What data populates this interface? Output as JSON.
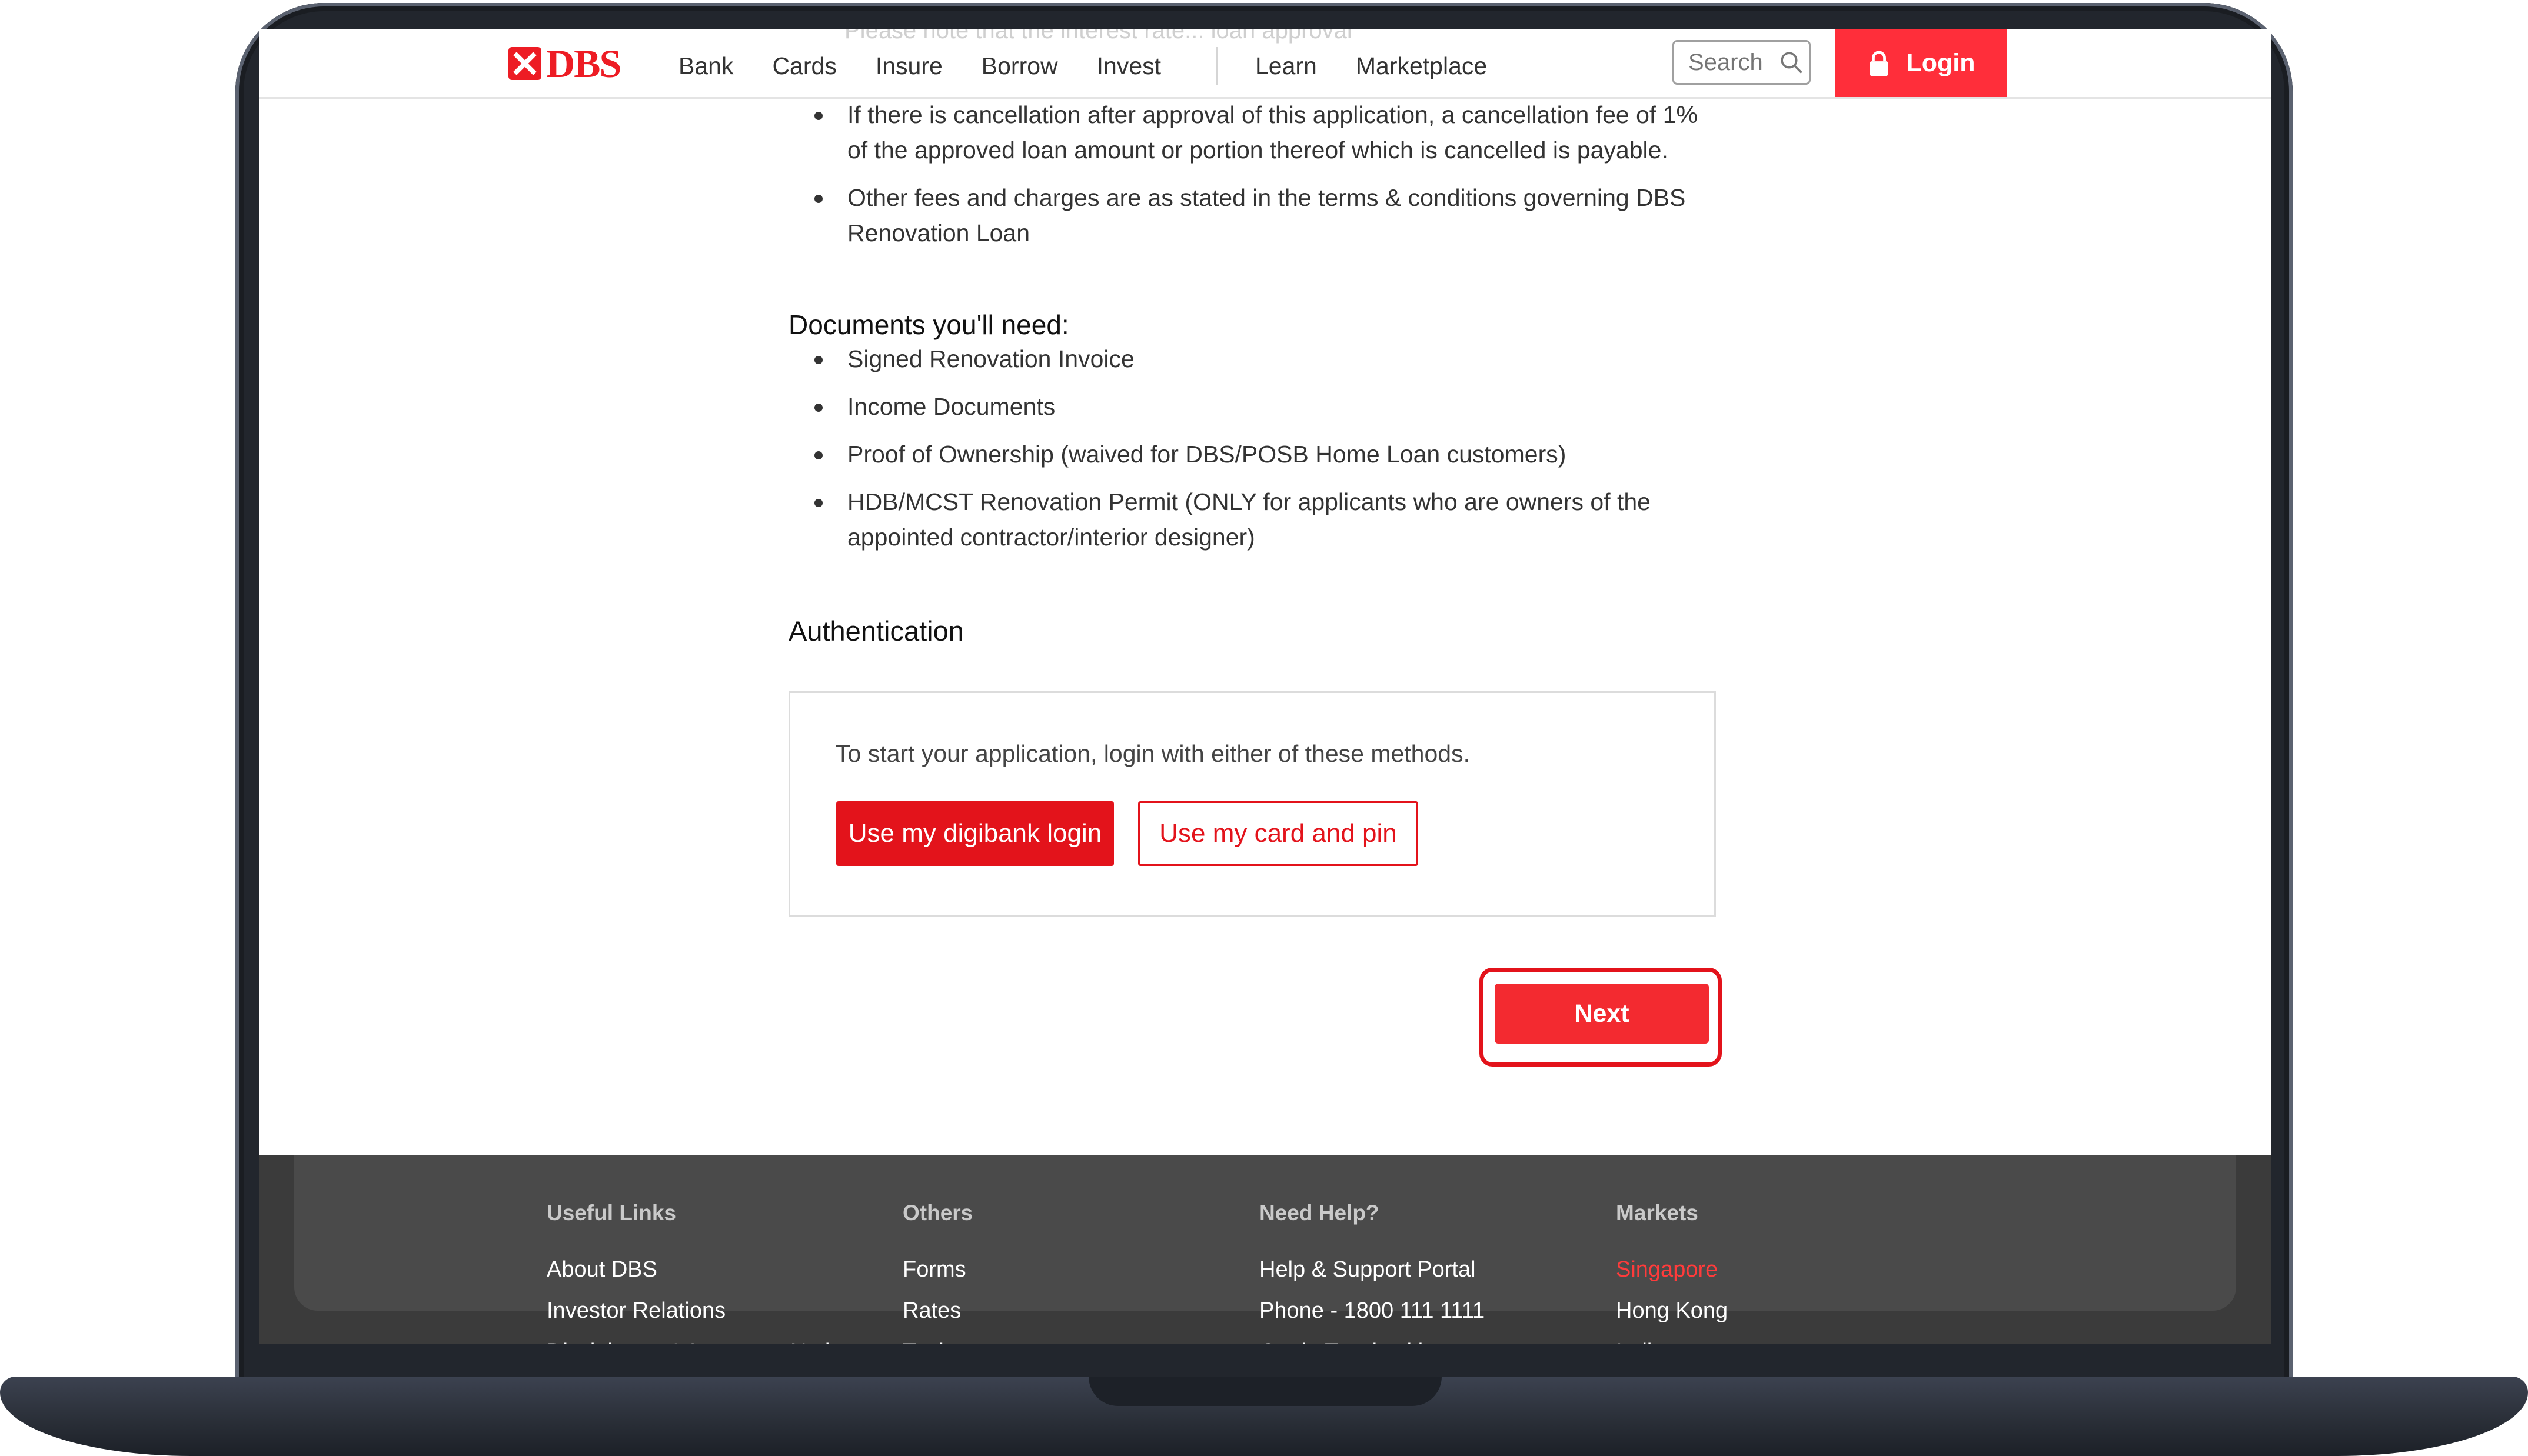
{
  "header": {
    "brand": "DBS",
    "nav_left": [
      "Bank",
      "Cards",
      "Insure",
      "Borrow",
      "Invest"
    ],
    "nav_right": [
      "Learn",
      "Marketplace"
    ],
    "search_placeholder": "Search",
    "login_label": "Login"
  },
  "fees": {
    "scrolled_under_header": "Please note that the interest rate... loan approval",
    "items": [
      "If there is cancellation after approval of this application, a cancellation fee of 1% of the approved loan amount or portion thereof which is cancelled is payable.",
      "Other fees and charges are as stated in the terms & conditions governing DBS Renovation Loan"
    ]
  },
  "documents": {
    "title": "Documents you'll need:",
    "items": [
      "Signed Renovation Invoice",
      "Income Documents",
      "Proof of Ownership (waived for DBS/POSB Home Loan customers)",
      "HDB/MCST Renovation Permit (ONLY for applicants who are owners of the appointed contractor/interior designer)"
    ]
  },
  "authentication": {
    "title": "Authentication",
    "instruction": "To start your application, login with either of these methods.",
    "digibank_button": "Use my digibank login",
    "card_pin_button": "Use my card and pin"
  },
  "next_button": "Next",
  "footer": {
    "columns": [
      {
        "heading": "Useful Links",
        "links": [
          "About DBS",
          "Investor Relations",
          "Disclaimers & Important Notices"
        ]
      },
      {
        "heading": "Others",
        "links": [
          "Forms",
          "Rates",
          "Tools"
        ]
      },
      {
        "heading": "Need Help?",
        "links": [
          "Help & Support Portal",
          "Phone - 1800 111 1111",
          "Get in Touch with Us"
        ]
      },
      {
        "heading": "Markets",
        "links": [
          "Singapore",
          "Hong Kong",
          "India"
        ]
      }
    ],
    "active_market": "Singapore"
  },
  "colors": {
    "brand_red": "#e3131b",
    "login_red": "#ff2e3a",
    "footer_bg": "#3b3b3b",
    "active_link": "#ff3b3b"
  },
  "icons": {
    "search": "search-icon",
    "lock": "lock-icon",
    "logo": "dbs-logo-icon"
  }
}
